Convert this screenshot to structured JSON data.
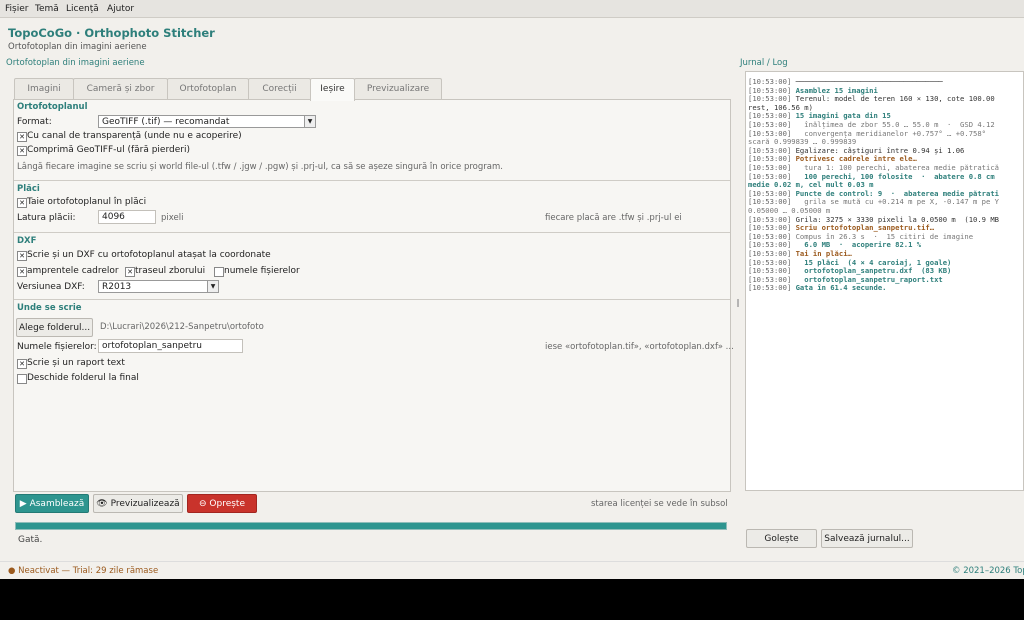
{
  "menu": [
    "Fișier",
    "Temă",
    "Licență",
    "Ajutor"
  ],
  "app": {
    "title": "TopoCoGo · Orthophoto Stitcher",
    "subtitle": "Ortofotoplan din imagini aeriene"
  },
  "left_section": "Ortofotoplan din imagini aeriene",
  "right_section": "Jurnal / Log",
  "tabs": [
    "Imagini",
    "Cameră și zbor",
    "Ortofotoplan",
    "Corecții",
    "Ieșire",
    "Previzualizare"
  ],
  "active_tab": "Ieșire",
  "ortofoto": {
    "group": "Ortofotoplanul",
    "format_label": "Format:",
    "format_value": "GeoTIFF (.tif) — recomandat",
    "transparency": "Cu canal de transparență (unde nu e acoperire)",
    "compress": "Comprimă GeoTIFF-ul (fără pierderi)",
    "note": "Lângă fiecare imagine se scriu și world file-ul (.tfw / .jgw / .pgw) și .prj-ul, ca să se așeze singură în orice program."
  },
  "tiles": {
    "group": "Plăci",
    "cut": "Taie ortofotoplanul în plăci",
    "width_label": "Latura plăcii:",
    "width_value": "4096",
    "unit": "pixeli",
    "hint": "fiecare placă are .tfw și .prj-ul ei"
  },
  "dxf": {
    "group": "DXF",
    "write": "Scrie și un DXF cu ortofotoplanul atașat la coordonate",
    "footprints": "amprentele cadrelor",
    "track": "traseul zborului",
    "filenames": "numele fișierelor",
    "version_label": "Versiunea DXF:",
    "version_value": "R2013"
  },
  "output": {
    "group": "Unde se scrie",
    "choose_button": "Alege folderul...",
    "folder": "D:\\Lucrari\\2026\\212-Sanpetru\\ortofoto",
    "name_label": "Numele fișierelor:",
    "name_value": "ortofotoplan_sanpetru",
    "name_hint": "iese «ortofotoplan.tif», «ortofotoplan.dxf» ...",
    "report": "Scrie și un raport text",
    "open_folder": "Deschide folderul la final"
  },
  "actions": {
    "assemble": "Asamblează",
    "preview": "Previzualizează",
    "stop": "Oprește",
    "license_hint": "starea licenței se vede în subsol"
  },
  "progress": 1.0,
  "status": "Gată.",
  "log": [
    {
      "t": "[10:53:00]",
      "text": " ──────────────────────────────────",
      "c": ""
    },
    {
      "t": "[10:53:00]",
      "text": " Asamblez 15 imagini",
      "c": "c-tealb"
    },
    {
      "t": "[10:53:00]",
      "text": " Terenul: model de teren 160 × 130, cote 100.00",
      "c": "c-bold0"
    },
    {
      "t": "",
      "text": "rest, 106.56 m)",
      "c": ""
    },
    {
      "t": "[10:53:00]",
      "text": " 15 imagini gata din 15",
      "c": "c-tealb"
    },
    {
      "t": "[10:53:00]",
      "text": "   înălțimea de zbor 55.0 … 55.0 m  ·  GSD 4.12",
      "c": "c-grey"
    },
    {
      "t": "[10:53:00]",
      "text": "   convergența meridianelor +0.757° … +0.758°",
      "c": "c-grey"
    },
    {
      "t": "",
      "text": "scară 0.999839 … 0.999839",
      "c": "c-grey"
    },
    {
      "t": "[10:53:00]",
      "text": " Egalizare: câștiguri între 0.94 și 1.06",
      "c": ""
    },
    {
      "t": "[10:53:00]",
      "text": " Potrivesc cadrele între ele…",
      "c": "c-brownb"
    },
    {
      "t": "[10:53:00]",
      "text": "   tura 1: 100 perechi, abaterea medie pătratică",
      "c": "c-grey"
    },
    {
      "t": "[10:53:00]",
      "text": "   100 perechi, 100 folosite  ·  abatere 0.8 cm",
      "c": "c-tealb"
    },
    {
      "t": "",
      "text": "medie 0.02 m, cel mult 0.03 m",
      "c": "c-tealb"
    },
    {
      "t": "[10:53:00]",
      "text": " Puncte de control: 9  ·  abaterea medie pătrati",
      "c": "c-tealb"
    },
    {
      "t": "[10:53:00]",
      "text": "   grila se mută cu +0.214 m pe X, -0.147 m pe Y",
      "c": "c-grey"
    },
    {
      "t": "",
      "text": "0.05000 … 0.05000 m",
      "c": "c-grey"
    },
    {
      "t": "[10:53:00]",
      "text": " Grila: 3275 × 3330 pixeli la 0.0500 m  (10.9 MB",
      "c": ""
    },
    {
      "t": "[10:53:00]",
      "text": " Scriu ortofotoplan_sanpetru.tif…",
      "c": "c-brownb"
    },
    {
      "t": "[10:53:00]",
      "text": " Compus în 26.3 s  ·  15 citiri de imagine",
      "c": "c-grey"
    },
    {
      "t": "[10:53:00]",
      "text": "   6.0 MB  ·  acoperire 82.1 %",
      "c": "c-tealb"
    },
    {
      "t": "[10:53:00]",
      "text": " Tai în plăci…",
      "c": "c-brownb"
    },
    {
      "t": "[10:53:00]",
      "text": "   15 plăci  (4 × 4 caroiaj, 1 goale)",
      "c": "c-tealb"
    },
    {
      "t": "[10:53:00]",
      "text": "   ortofotoplan_sanpetru.dxf  (83 KB)",
      "c": "c-tealb"
    },
    {
      "t": "[10:53:00]",
      "text": "   ortofotoplan_sanpetru_raport.txt",
      "c": "c-tealb"
    },
    {
      "t": "[10:53:00]",
      "text": " Gata în 61.4 secunde.",
      "c": "c-tealb"
    }
  ],
  "log_buttons": {
    "clear": "Golește",
    "save": "Salvează jurnalul..."
  },
  "footer": {
    "left": "● Neactivat — Trial: 29 zile rămase",
    "right": "© 2021–2026 Top"
  },
  "colors": {
    "accent": "#2e958f",
    "stop": "#c9332b",
    "warning": "#9b5a1e"
  }
}
